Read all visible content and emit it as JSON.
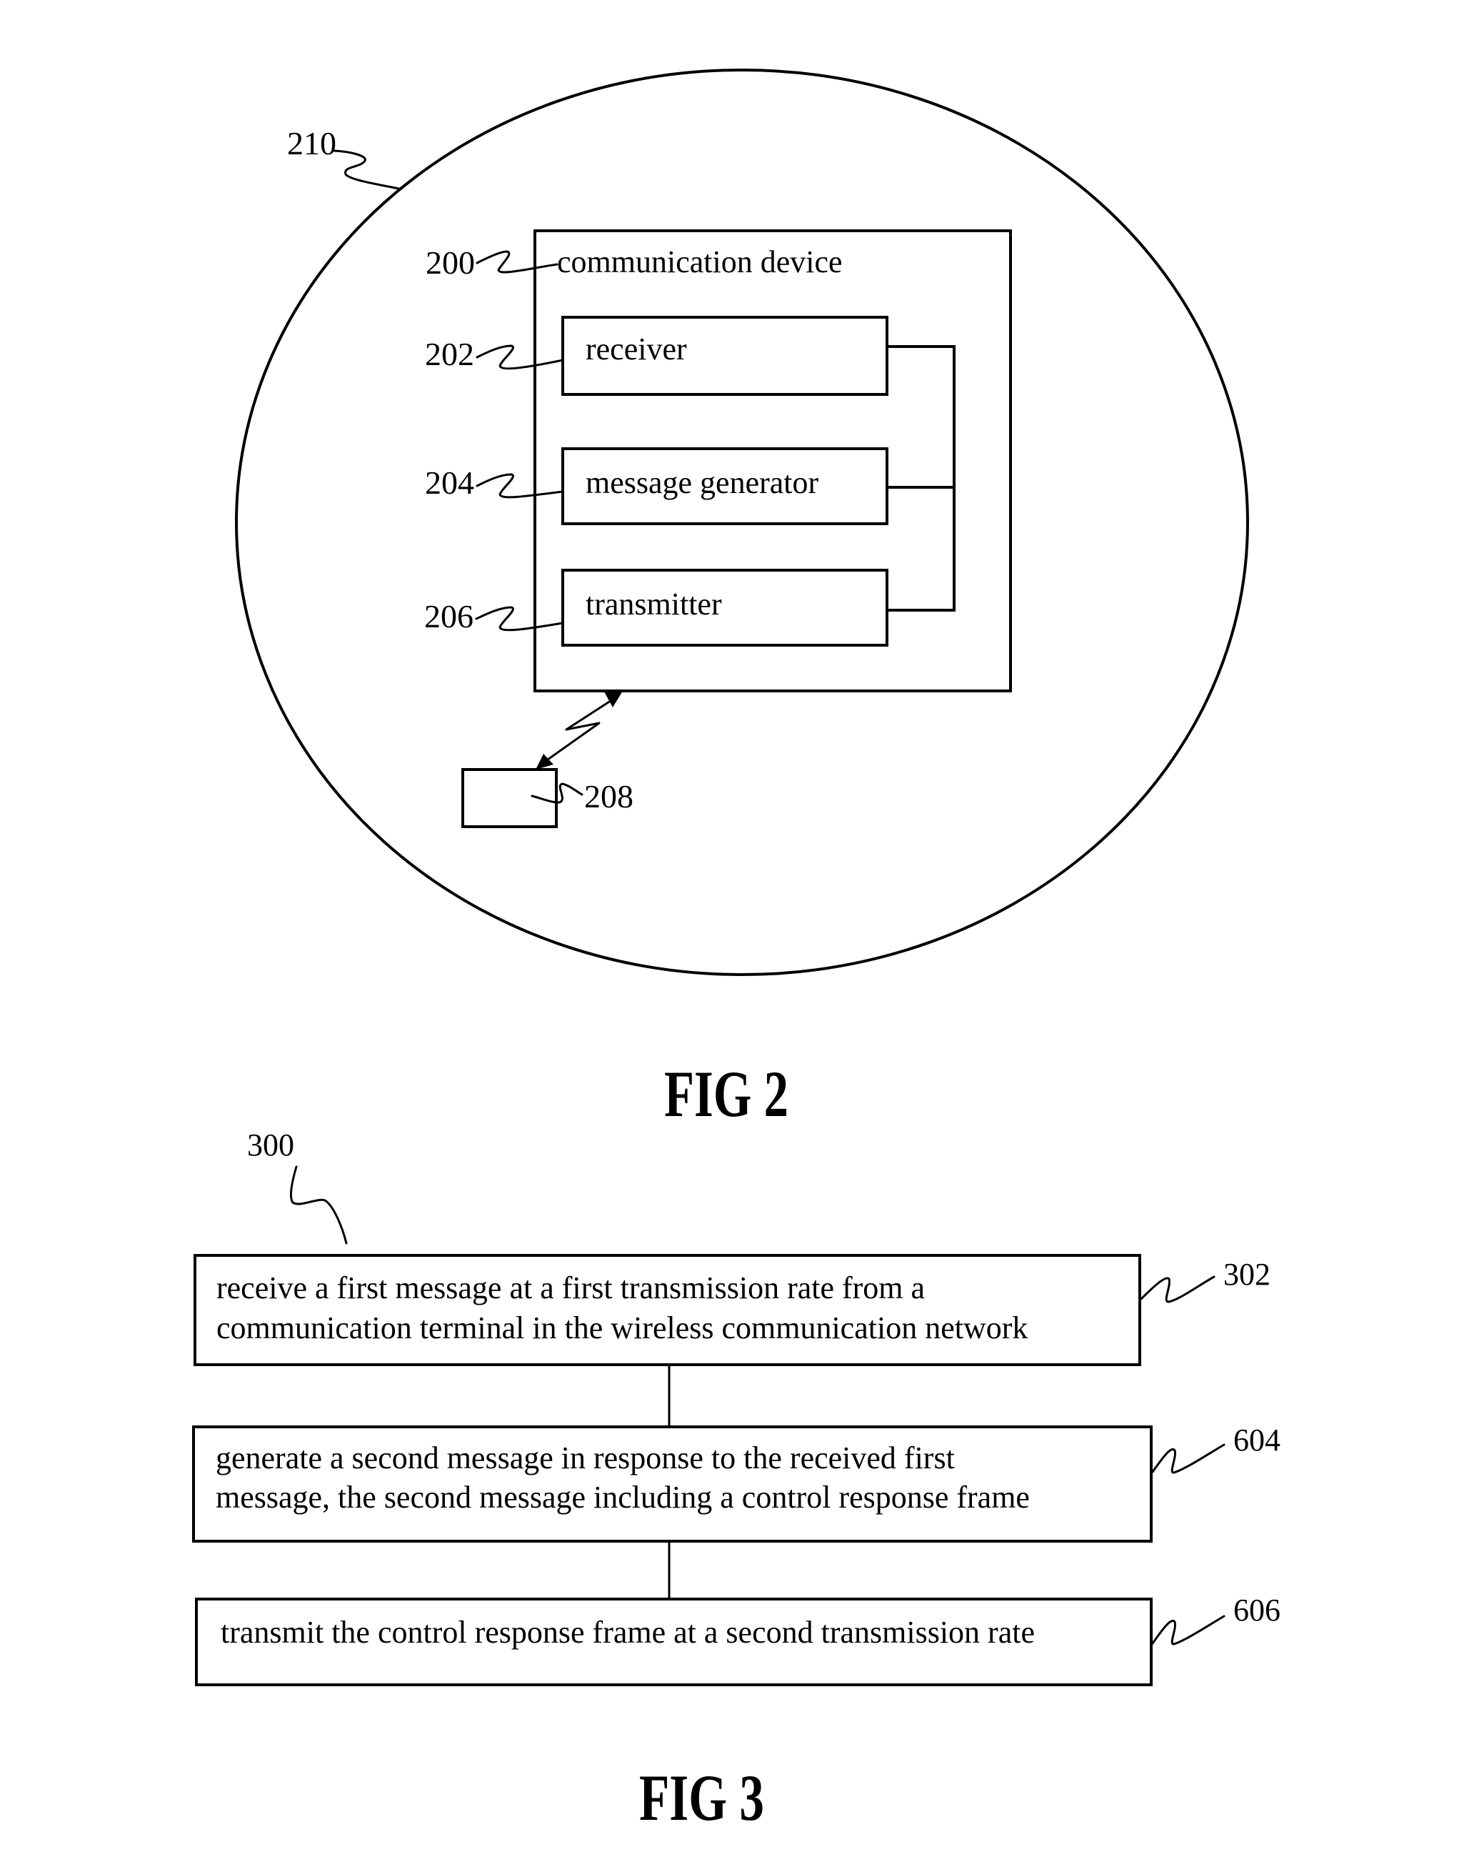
{
  "page": {
    "background": "#ffffff",
    "ink": "#000000"
  },
  "fig2": {
    "caption": "FIG 2",
    "network": {
      "ref": "210"
    },
    "device": {
      "ref": "200",
      "label": "communication device",
      "components": [
        {
          "ref": "202",
          "label": "receiver"
        },
        {
          "ref": "204",
          "label": "message generator"
        },
        {
          "ref": "206",
          "label": "transmitter"
        }
      ]
    },
    "terminal": {
      "ref": "208"
    }
  },
  "fig3": {
    "caption": "FIG 3",
    "method_ref": "300",
    "steps": [
      {
        "ref": "302",
        "lines": [
          "receive a first message at a first transmission rate from a",
          "communication terminal in the wireless communication network"
        ]
      },
      {
        "ref": "604",
        "lines": [
          "generate a second message in response to the received first",
          "message, the second message including a control response frame"
        ]
      },
      {
        "ref": "606",
        "lines": [
          "transmit the control response frame at a second transmission rate"
        ]
      }
    ]
  }
}
